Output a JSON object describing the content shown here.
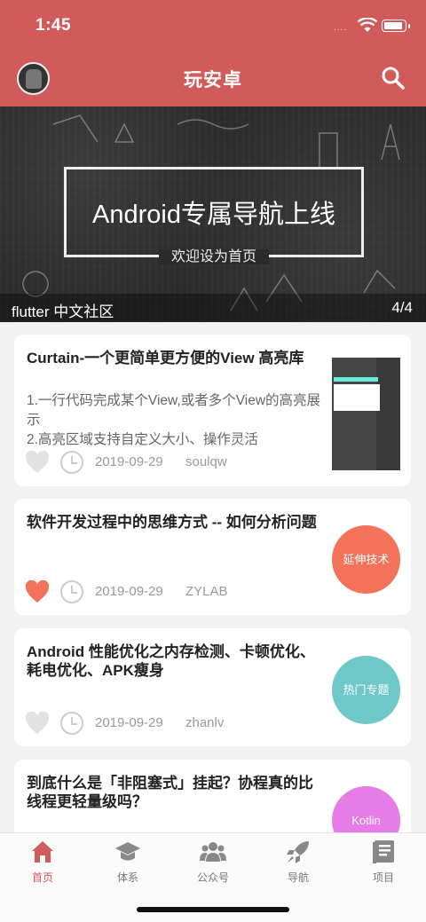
{
  "status": {
    "time": "1:45",
    "signal_dots": "....",
    "battery_level": 0.9
  },
  "appbar": {
    "title": "玩安卓",
    "avatar": "avatar",
    "search_icon": "search-icon"
  },
  "banner": {
    "headline": "Android专属导航上线",
    "subtitle": "欢迎设为首页",
    "caption": "flutter 中文社区",
    "pager": "4/4"
  },
  "articles": [
    {
      "title": "Curtain-一个更简单更方便的View 高亮库",
      "desc_lines": [
        "1.一行代码完成某个View,或者多个View的高亮展示",
        "2.高亮区域支持自定义大小、操作灵活"
      ],
      "date": "2019-09-29",
      "author": "soulqw",
      "liked": false,
      "thumb": "screenshot-thumbnail"
    },
    {
      "title": "软件开发过程中的思维方式 -- 如何分析问题",
      "date": "2019-09-29",
      "author": "ZYLAB",
      "liked": true,
      "tag": "延伸技术",
      "tag_color": "#f4725a"
    },
    {
      "title": "Android 性能优化之内存检测、卡顿优化、耗电优化、APK瘦身",
      "date": "2019-09-29",
      "author": "zhanlv",
      "liked": false,
      "tag": "热门专题",
      "tag_color": "#6ec8c8"
    },
    {
      "title": "到底什么是「非阻塞式」挂起？协程真的比线程更轻量级吗？",
      "tag": "Kotlin",
      "tag_color": "#e67ce6"
    }
  ],
  "tabs": [
    {
      "label": "首页",
      "icon": "home-icon",
      "active": true
    },
    {
      "label": "体系",
      "icon": "graduation-cap-icon",
      "active": false
    },
    {
      "label": "公众号",
      "icon": "people-icon",
      "active": false
    },
    {
      "label": "导航",
      "icon": "rocket-icon",
      "active": false
    },
    {
      "label": "项目",
      "icon": "book-icon",
      "active": false
    }
  ],
  "colors": {
    "primary": "#d15a5a",
    "heart_active": "#f4725a",
    "heart_inactive": "#e0e0e0"
  }
}
